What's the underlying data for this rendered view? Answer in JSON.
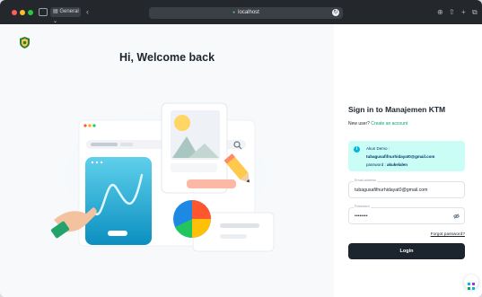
{
  "browser": {
    "tab_group_label": "General",
    "url": "localhost"
  },
  "left": {
    "heading": "Hi, Welcome back"
  },
  "signin": {
    "title": "Sign in to Manajemen KTM",
    "new_user_text": "New user?",
    "create_account_link": "Create an account",
    "demo_title": "Akun Demo :",
    "demo_email": "tubagusafifnurhidayat0@gmail.com",
    "demo_password_label": "password :",
    "demo_password": "akukelalen",
    "email_label": "Email address",
    "email_value": "tubagusafifnurhidayat0@gmail.com",
    "password_label": "Password",
    "password_value": "••••••••",
    "forgot_link": "Forgot password?",
    "login_button": "Login"
  },
  "colors": {
    "accent": "#00a76f",
    "alert_bg": "#cafdf5",
    "primary_dark": "#1c252e",
    "illustration_cyan": "#1aa9d1"
  },
  "icons": [
    "sidebar-icon",
    "back-icon",
    "shield-icon",
    "reload-icon",
    "download-icon",
    "share-icon",
    "new-tab-icon",
    "tabs-icon",
    "info-icon",
    "eye-off-icon",
    "settings-fab-icon"
  ]
}
